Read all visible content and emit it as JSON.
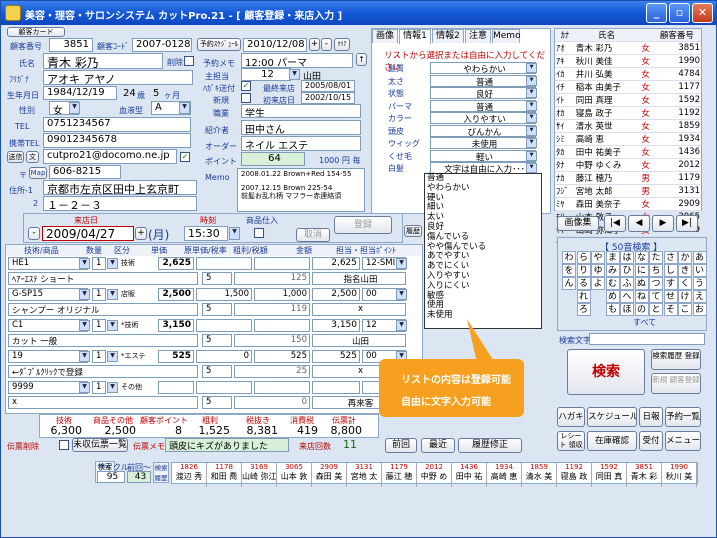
{
  "window": {
    "title": "美容・理容・サロンシステム カットPro.21 - [ 顧客登録・来店入力 ]",
    "min": "_",
    "max": "▫",
    "close": "✕"
  },
  "top": {
    "customer_card": "顧客カード",
    "no_label": "顧客番号",
    "no": "3851",
    "code_label": "顧客ｺｰﾄﾞ",
    "code": "2007-0128",
    "sched_label": "予約ｽｹｼﾞｭｰﾙ",
    "sched_date": "2010/12/08",
    "nav_add": "+",
    "nav_sub": "-",
    "clear": "ｸﾘｱ",
    "name_label": "氏名",
    "name": "青木 彩乃",
    "delete_label": "削除",
    "kana_label": "ﾌﾘｶﾞﾅ",
    "kana": "アオキ アヤノ",
    "birth_label": "生年月日",
    "birth": "1984/12/19",
    "age": "24",
    "age_unit": "歳",
    "months": "5",
    "month_unit": "ヶ月",
    "gender_label": "性別",
    "gender": "女",
    "blood_label": "血液型",
    "blood": "A",
    "tel_label": "TEL",
    "tel": "0751234567",
    "mobile_label": "携帯TEL",
    "mobile": "09012345678",
    "mail_btn": "送信",
    "mail_btn2": "文",
    "email": "cutpro21@docomo.ne.jp",
    "zip_label": "〒",
    "map_btn": "Map",
    "zip": "606-8215",
    "addr_label": "住所-1",
    "addr1": "京都市左京区田中上玄京町",
    "addr2_label": "2",
    "addr2": "１－２－３"
  },
  "mid": {
    "memo_label": "予約メモ",
    "memo_time": "12:00 パーマ",
    "staff_label": "主担当",
    "staff_no": "12",
    "staff_name": "山田",
    "last_label": "最終来店",
    "last_date": "2005/08/01",
    "first_label": "初来店日",
    "first_date": "2002/10/15",
    "dm_label": "ﾊｶﾞｷ送付",
    "new_label": "新規",
    "job_label": "職業",
    "job": "学生",
    "intro_label": "紹介者",
    "intro": "田中さん",
    "order_label": "オーダー",
    "order": "ネイル エステ",
    "point_label": "ポイント",
    "points": "64",
    "point_rate": "1000 円 毎",
    "memo2_label": "Memo",
    "memo2_line1": "2008.01.22 Brown+Red 154-55",
    "memo2_line2": "2007.12.15 Brown 225-54",
    "memo2_line3": "前髪お乱れ柄 マフラー赤連絡須"
  },
  "info": {
    "tabs": [
      "画像",
      "情報1",
      "情報2",
      "注意",
      "Memo"
    ],
    "hint": "リストから選択または自由に入力してください",
    "rows": [
      {
        "k": "髪質",
        "v": "やわらかい"
      },
      {
        "k": "太さ",
        "v": "普通"
      },
      {
        "k": "状態",
        "v": "良好"
      },
      {
        "k": "パーマ",
        "v": "普通"
      },
      {
        "k": "カラー",
        "v": "入りやすい"
      },
      {
        "k": "頭皮",
        "v": "びんかん"
      },
      {
        "k": "ウィッグ",
        "v": "未使用"
      },
      {
        "k": "くせ毛",
        "v": "軽い"
      },
      {
        "k": "白髪",
        "v": "文字は自由に入力･･･"
      }
    ],
    "options": [
      "普通",
      "やわらかい",
      "硬い",
      "細い",
      "太い",
      "良好",
      "傷んでいる",
      "やや傷んでいる",
      "あでやすい",
      "あでにくい",
      "入りやすい",
      "入りにくい",
      "敏感",
      "使用",
      "未使用"
    ]
  },
  "customers": {
    "h_kana": "ｶﾅ",
    "h_name": "氏名",
    "h_no": "顧客番号",
    "rows": [
      [
        "ｱｵ",
        "青木 彩乃",
        "女",
        "3851"
      ],
      [
        "ｱｷ",
        "秋川 美佳",
        "女",
        "1990"
      ],
      [
        "ｲｶ",
        "井川 弘美",
        "女",
        "4784"
      ],
      [
        "ｲﾁ",
        "稲本 由美子",
        "女",
        "1177"
      ],
      [
        "ｲﾄ",
        "同田 真理",
        "女",
        "1592"
      ],
      [
        "ｵｶ",
        "寝島 政子",
        "女",
        "1192"
      ],
      [
        "ｻｲ",
        "清水 英世",
        "女",
        "1859"
      ],
      [
        "ｼﾐ",
        "高崎 恵",
        "女",
        "1934"
      ],
      [
        "ﾀｶ",
        "田中 祐美子",
        "女",
        "1436"
      ],
      [
        "ﾀﾅ",
        "中野 ゆくみ",
        "女",
        "2012"
      ],
      [
        "ﾅｶ",
        "藤江 穂乃",
        "男",
        "1179"
      ],
      [
        "ﾌｼﾞ",
        "宮地 太郎",
        "男",
        "3131"
      ],
      [
        "ﾐﾔ",
        "森田 美奈子",
        "女",
        "2909"
      ],
      [
        "ﾓﾘ",
        "山本 敦子",
        "女",
        "3065"
      ],
      [
        "ﾔﾏ",
        "山崎 弥江子",
        "女",
        "3169"
      ],
      [
        "ﾔﾏ",
        "和田 喬",
        "男",
        "1178"
      ]
    ]
  },
  "visit": {
    "date_label": "来店日",
    "date": "2009/04/27",
    "weekday": "(月)",
    "time_label": "時刻",
    "time": "15:30",
    "item_label": "商品仕入",
    "register": "登録",
    "cancel": "取消",
    "history": "履歴",
    "headers": [
      "技術/商品",
      "数量",
      "区分",
      "単価",
      "原単価/税率",
      "粗利/税額",
      "金額",
      "担当・担当ﾎﾟｲﾝﾄ"
    ],
    "lines": [
      {
        "code": "HE1",
        "qty": "1",
        "kind": "技術",
        "price": "2,625",
        "cost": "",
        "gross": "",
        "amount": "2,625",
        "staff": "12-SMI",
        "name": "ﾍｱｰｴｽﾃ ショート",
        "rate": "5",
        "tax": "125",
        "staffname": "指名山田"
      },
      {
        "code": "G-SP15",
        "qty": "1",
        "kind": "店販",
        "price": "2,500",
        "cost": "1,500",
        "gross": "1,000",
        "amount": "2,500",
        "staff": "00",
        "name": "シャンプー オリジナル",
        "rate": "5",
        "tax": "119",
        "staffname": "x"
      },
      {
        "code": "C1",
        "qty": "1",
        "kind": "*技術",
        "price": "3,150",
        "cost": "",
        "gross": "",
        "amount": "3,150",
        "staff": "12",
        "name": "カット 一般",
        "rate": "5",
        "tax": "150",
        "staffname": "山田"
      },
      {
        "code": "19",
        "qty": "1",
        "kind": "*エステ",
        "price": "525",
        "cost": "0",
        "gross": "525",
        "amount": "525",
        "staff": "00",
        "name": "←ﾀﾞﾌﾞﾙｸﾘｯｸで登録",
        "rate": "5",
        "tax": "25",
        "staffname": "x"
      },
      {
        "code": "9999",
        "qty": "1",
        "kind": "その他",
        "price": "",
        "cost": "",
        "gross": "",
        "amount": "",
        "staff": "",
        "name": "x",
        "rate": "5",
        "tax": "0",
        "staffname": "再来客"
      }
    ],
    "note_line1": "リストの内容は登録可能",
    "note_line2": "自由に文字入力可能"
  },
  "summary": {
    "labels": [
      "技術",
      "商品その他",
      "顧客ポイント",
      "粗利",
      "税抜き",
      "消費税",
      "伝票計"
    ],
    "values": [
      "6,300",
      "2,500",
      "8",
      "1,525",
      "8,381",
      "419",
      "8,800"
    ],
    "slip_del": "伝票削除",
    "unsent": "未収伝票一覧",
    "slip_memo_label": "伝票メモ",
    "slip_memo": "頭皮にキズがありました",
    "visits_label": "来店回数",
    "visits": "11",
    "prev": "前回",
    "recent": "最近",
    "fix": "履歴修正"
  },
  "right": {
    "image_btn": "画像集",
    "first": "|◀",
    "back": "◀",
    "fwd": "▶",
    "last": "▶|",
    "kana_title": "【 50音検索 】",
    "kana": [
      [
        "わ",
        "ら",
        "や",
        "ま",
        "は",
        "な",
        "た",
        "さ",
        "か",
        "あ"
      ],
      [
        "を",
        "り",
        "ゆ",
        "み",
        "ひ",
        "に",
        "ち",
        "し",
        "き",
        "い"
      ],
      [
        "ん",
        "る",
        "よ",
        "む",
        "ふ",
        "ぬ",
        "つ",
        "す",
        "く",
        "う"
      ],
      [
        "",
        "れ",
        "",
        "め",
        "へ",
        "ね",
        "て",
        "せ",
        "け",
        "え"
      ],
      [
        "",
        "ろ",
        "",
        "も",
        "ほ",
        "の",
        "と",
        "そ",
        "こ",
        "お"
      ]
    ],
    "all": "すべて",
    "search_text": "検索文字",
    "search": "検索",
    "hist_search": "検索履歴 登録",
    "new_reg": "新規 顧客登録",
    "btns": [
      "ハガキ",
      "スケジュール",
      "日報",
      "予約一覧",
      "レシート 領収書",
      "在庫確認",
      "受付",
      "メニュー"
    ]
  },
  "bottom": {
    "cycle_label": "サイクル",
    "prev_label": "前回～",
    "cycle": "95",
    "prev": "43",
    "hist_label": "検索履歴",
    "strip": [
      [
        "1826",
        "渡辺 秀"
      ],
      [
        "1178",
        "和田 喬"
      ],
      [
        "3169",
        "山崎 弥江"
      ],
      [
        "3065",
        "山本 敦"
      ],
      [
        "2909",
        "森田 美"
      ],
      [
        "3131",
        "宮地 太"
      ],
      [
        "1179",
        "藤江 穂"
      ],
      [
        "2012",
        "中野 め"
      ],
      [
        "1436",
        "田中 祐"
      ],
      [
        "1934",
        "高崎 恵"
      ],
      [
        "1859",
        "清水 美"
      ],
      [
        "1192",
        "寝島 政"
      ],
      [
        "1592",
        "同田 真"
      ],
      [
        "3851",
        "青木 彩"
      ],
      [
        "1990",
        "秋川 美"
      ]
    ]
  }
}
